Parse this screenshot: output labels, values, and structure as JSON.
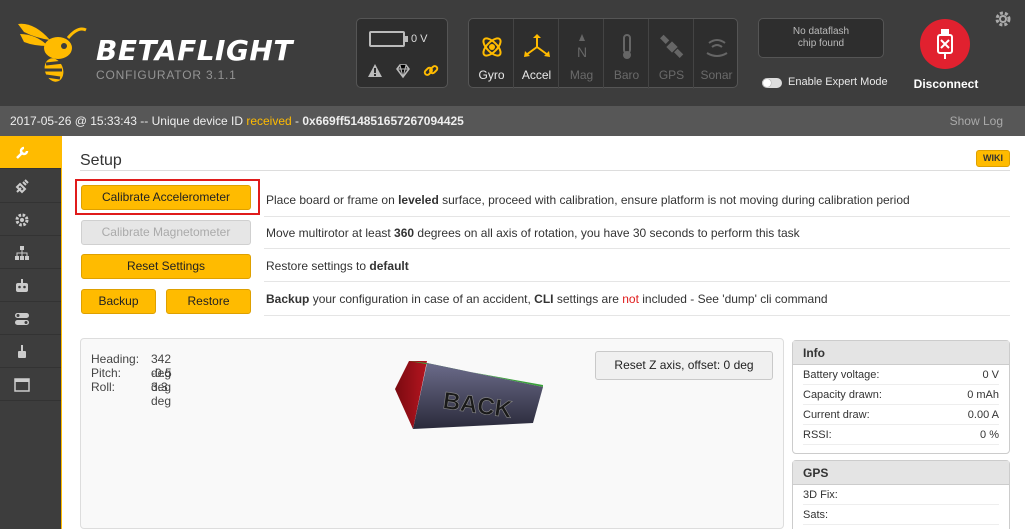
{
  "header": {
    "brand": "BETAFLIGHT",
    "subtitle": "CONFIGURATOR  3.1.1",
    "battery_voltage": "0 V",
    "sensors": [
      {
        "label": "Gyro",
        "active": true,
        "icon": "gyro-icon"
      },
      {
        "label": "Accel",
        "active": true,
        "icon": "accel-icon"
      },
      {
        "label": "Mag",
        "active": false,
        "icon": "mag-icon"
      },
      {
        "label": "Baro",
        "active": false,
        "icon": "baro-icon"
      },
      {
        "label": "GPS",
        "active": false,
        "icon": "gps-icon"
      },
      {
        "label": "Sonar",
        "active": false,
        "icon": "sonar-icon"
      }
    ],
    "dataflash_line1": "No dataflash",
    "dataflash_line2": "chip found",
    "expert_mode_label": "Enable Expert Mode",
    "disconnect_label": "Disconnect"
  },
  "logbar": {
    "prefix": "2017-05-26 @ 15:33:43 -- Unique device ID ",
    "received": "received",
    "dash": " - ",
    "device_id": "0x669ff514851657267094425",
    "show_log": "Show Log"
  },
  "setup": {
    "title": "Setup",
    "wiki": "WIKI",
    "calibrate_acc": "Calibrate Accelerometer",
    "calibrate_mag": "Calibrate Magnetometer",
    "reset_settings": "Reset Settings",
    "backup": "Backup",
    "restore": "Restore",
    "desc_acc_1": "Place board or frame on ",
    "desc_acc_bold": "leveled",
    "desc_acc_2": " surface, proceed with calibration, ensure platform is not moving during calibration period",
    "desc_mag_1": "Move multirotor at least ",
    "desc_mag_bold": "360",
    "desc_mag_2": " degrees on all axis of rotation, you have 30 seconds to perform this task",
    "desc_reset_1": "Restore settings to ",
    "desc_reset_bold": "default",
    "desc_backup_bold1": "Backup",
    "desc_backup_1": " your configuration in case of an accident, ",
    "desc_backup_bold2": "CLI",
    "desc_backup_2": " settings are ",
    "desc_backup_red": "not",
    "desc_backup_3": " included - See 'dump' cli command"
  },
  "attitude": {
    "heading_label": "Heading:",
    "heading_value": "342 deg",
    "pitch_label": "Pitch:",
    "pitch_value": "-0.5 deg",
    "roll_label": "Roll:",
    "roll_value": "3.3 deg",
    "reset_z": "Reset Z axis, offset: 0 deg",
    "model_text": "BACK"
  },
  "info": {
    "title": "Info",
    "rows": [
      {
        "k": "Battery voltage:",
        "v": "0 V"
      },
      {
        "k": "Capacity drawn:",
        "v": "0 mAh"
      },
      {
        "k": "Current draw:",
        "v": "0.00 A"
      },
      {
        "k": "RSSI:",
        "v": "0 %"
      }
    ]
  },
  "gps": {
    "title": "GPS",
    "rows": [
      {
        "k": "3D Fix:",
        "v": ""
      },
      {
        "k": "Sats:",
        "v": ""
      }
    ]
  },
  "colors": {
    "accent": "#ffbb00",
    "disconnect": "#e1212f",
    "highlight": "#e01b1b"
  }
}
